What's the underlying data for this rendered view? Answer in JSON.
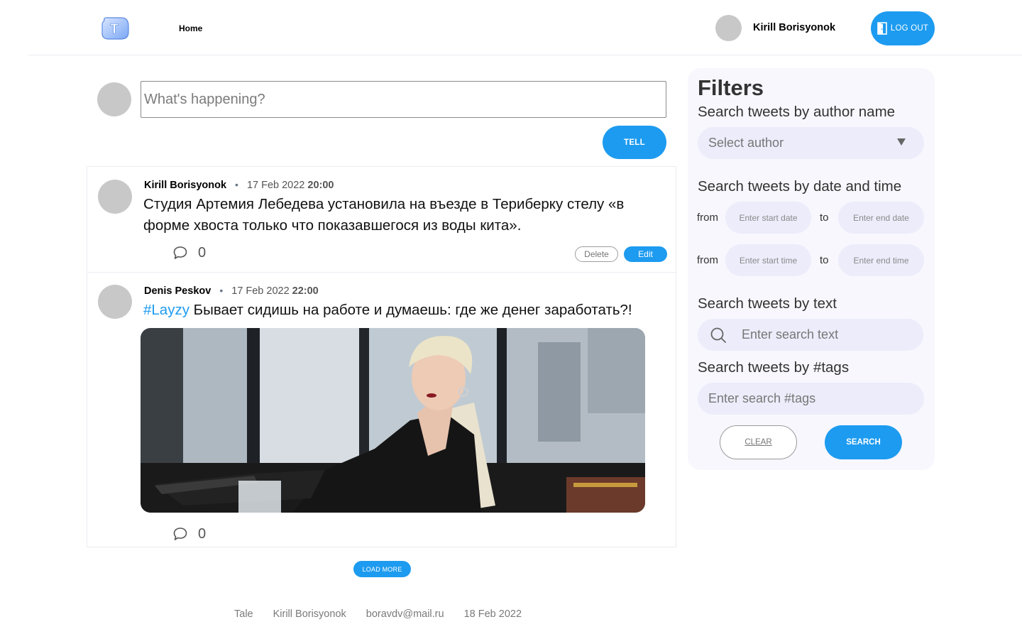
{
  "header": {
    "logo_letter": "T",
    "nav_home": "Home",
    "username": "Kirill Borisyonok",
    "logout_label": "LOG OUT"
  },
  "composer": {
    "placeholder": "What's happening?",
    "tell_label": "TELL"
  },
  "tweets": [
    {
      "author": "Kirill Borisyonok",
      "separator": "•",
      "date": "17 Feb 2022",
      "time": "20:00",
      "hashtag": "",
      "text": "Студия Артемия Лебедева установила на въезде в Териберку стелу «в форме хвоста только что показавшегося из воды кита».",
      "comment_count": "0",
      "delete_label": "Delete",
      "edit_label": "Edit"
    },
    {
      "author": "Denis Peskov",
      "separator": "•",
      "date": "17 Feb 2022",
      "time": "22:00",
      "hashtag": "#Layzy",
      "text": "Бывает сидишь на работе и думаешь: где же денег заработать?!",
      "comment_count": "0"
    }
  ],
  "load_more_label": "LOAD MORE",
  "footer": {
    "app": "Tale",
    "author": "Kirill Borisyonok",
    "email": "boravdv@mail.ru",
    "date": "18 Feb 2022"
  },
  "filters": {
    "title": "Filters",
    "author_label": "Search tweets by author name",
    "author_select_value": "Select author",
    "datetime_label": "Search tweets by date and time",
    "from_label": "from",
    "to_label": "to",
    "start_date_placeholder": "Enter start date",
    "end_date_placeholder": "Enter end date",
    "start_time_placeholder": "Enter start time",
    "end_time_placeholder": "Enter end time",
    "text_label": "Search tweets by text",
    "text_placeholder": "Enter search text",
    "tags_label": "Search tweets by #tags",
    "tags_placeholder": "Enter search #tags",
    "clear_label": "CLEAR",
    "search_label": "SEARCH"
  },
  "colors": {
    "accent": "#1d9bf0",
    "avatar": "#c8c8c8",
    "filter_bg": "#f7f7fd",
    "pill_bg": "#ececfb"
  },
  "icons": [
    "app-logo-icon",
    "door-exit-icon",
    "comment-icon",
    "search-icon",
    "chevron-down-icon"
  ]
}
